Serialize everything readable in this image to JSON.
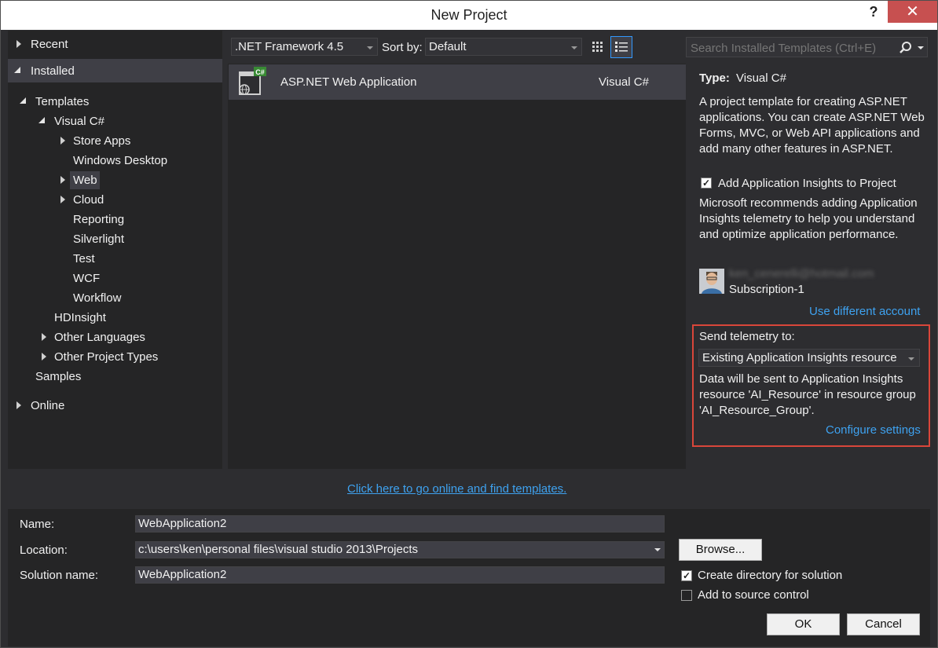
{
  "window": {
    "title": "New Project",
    "help": "?",
    "close": "✕"
  },
  "left_tree": {
    "recent": "Recent",
    "installed": "Installed",
    "templates": "Templates",
    "visual_csharp": "Visual C#",
    "children": [
      "Store Apps",
      "Windows Desktop",
      "Web",
      "Cloud",
      "Reporting",
      "Silverlight",
      "Test",
      "WCF",
      "Workflow"
    ],
    "hdinsight": "HDInsight",
    "other_languages": "Other Languages",
    "other_project_types": "Other Project Types",
    "samples": "Samples",
    "online": "Online"
  },
  "toolbar": {
    "framework": ".NET Framework 4.5",
    "sort_label": "Sort by:",
    "sort_value": "Default",
    "search_placeholder": "Search Installed Templates (Ctrl+E)"
  },
  "templates": [
    {
      "name": "ASP.NET Web Application",
      "lang": "Visual C#",
      "badge": "C#"
    }
  ],
  "find_online_link": "Click here to go online and find templates.",
  "details": {
    "type_label": "Type:",
    "type_value": "Visual C#",
    "description": "A project template for creating ASP.NET applications. You can create ASP.NET Web Forms, MVC,  or Web API applications and add many other features in ASP.NET.",
    "insights_label": "Add Application Insights to Project",
    "insights_desc": "Microsoft recommends adding Application Insights telemetry to help you understand and optimize application performance.",
    "account_email": "ken_cenerelli@hotmail.com",
    "subscription": "Subscription-1",
    "different_account": "Use different account",
    "send_telemetry_label": "Send telemetry to:",
    "telemetry_value": "Existing Application Insights resource",
    "data_sent_text": "Data will be sent to Application Insights resource 'AI_Resource' in resource group 'AI_Resource_Group'.",
    "configure_settings": "Configure settings"
  },
  "form": {
    "name_label": "Name:",
    "name_value": "WebApplication2",
    "location_label": "Location:",
    "location_value": "c:\\users\\ken\\personal files\\visual studio 2013\\Projects",
    "solution_label": "Solution name:",
    "solution_value": "WebApplication2",
    "browse": "Browse...",
    "create_dir": "Create directory for solution",
    "source_control": "Add to source control",
    "ok": "OK",
    "cancel": "Cancel"
  },
  "colors": {
    "accent": "#3399ff",
    "highlight_box": "#d9463a",
    "selected_row": "#3f3f46",
    "link": "#3ea2f0"
  }
}
